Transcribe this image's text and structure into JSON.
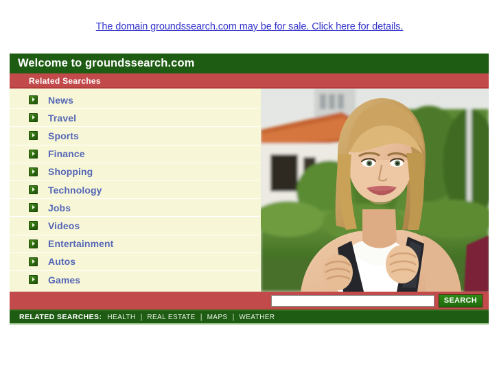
{
  "promo": {
    "text": "The domain groundssearch.com may be for sale. Click here for details.",
    "color": "#3333cc"
  },
  "header": {
    "title": "Welcome to groundssearch.com",
    "subtitle": "Related Searches",
    "title_bg": "#1d5c12",
    "subtitle_bg": "#c24a4a"
  },
  "related_searches": {
    "bullet_icon": "green-chevron-icon",
    "items": [
      {
        "label": "News"
      },
      {
        "label": "Travel"
      },
      {
        "label": "Sports"
      },
      {
        "label": "Finance"
      },
      {
        "label": "Shopping"
      },
      {
        "label": "Technology"
      },
      {
        "label": "Jobs"
      },
      {
        "label": "Videos"
      },
      {
        "label": "Entertainment"
      },
      {
        "label": "Autos"
      },
      {
        "label": "Games"
      }
    ],
    "link_color": "#5566b5",
    "row_bg": "#f7f7d8"
  },
  "photo": {
    "alt": "Smiling blonde young woman wearing a white tank top and dark backpack, standing outdoors in front of a tiled-roof building and green hedge"
  },
  "search": {
    "value": "",
    "placeholder": "",
    "button_label": "SEARCH",
    "band_bg": "#c24a4a"
  },
  "footer": {
    "title": "RELATED SEARCHES:",
    "links": [
      "HEALTH",
      "REAL ESTATE",
      "MAPS",
      "WEATHER"
    ],
    "separator": "|",
    "bg": "#1d5c12"
  }
}
